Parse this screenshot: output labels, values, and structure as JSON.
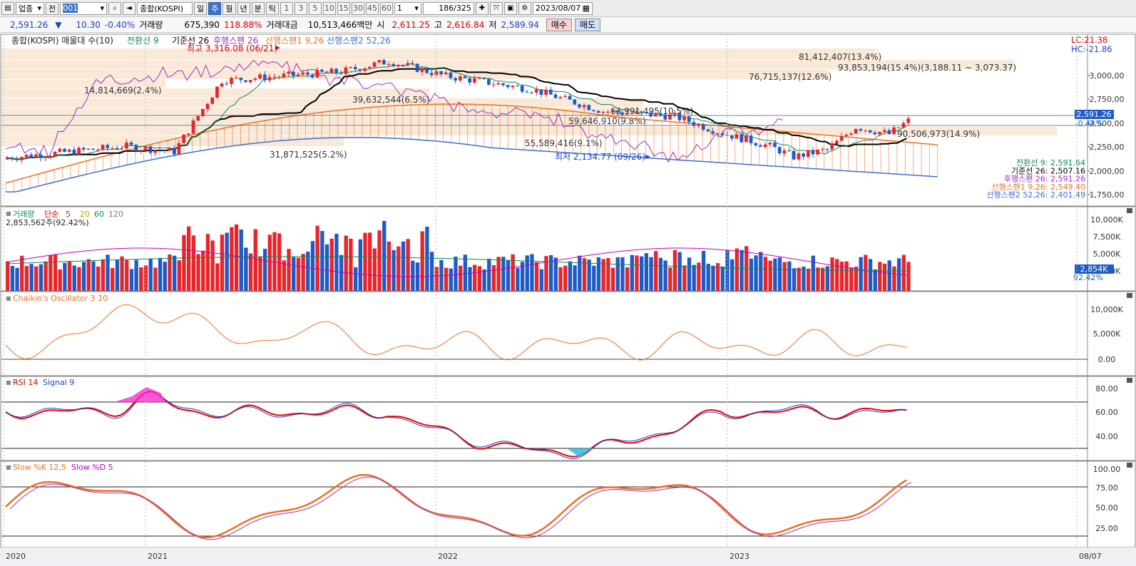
{
  "toolbar": {
    "market": "업종",
    "prev_label": "전",
    "code": "001",
    "index_name": "종합(KOSPI)",
    "periods": [
      "일",
      "주",
      "월",
      "년",
      "분",
      "틱"
    ],
    "selected_period": "주",
    "tick_numbers": [
      "1",
      "3",
      "5",
      "10",
      "15",
      "30",
      "45",
      "60"
    ],
    "interval": "1",
    "count": "186",
    "total": "/325",
    "date": "2023/08/07"
  },
  "quote": {
    "price": "2,591.26",
    "arrow": "▼",
    "change": "10.30",
    "pct": "-0.40%",
    "vol_label": "거래량",
    "volume": "675,390",
    "vol_ratio": "118.88%",
    "amt_label": "거래대금",
    "amount": "10,513,466백만",
    "open_label": "시",
    "open": "2,611.25",
    "high_label": "고",
    "high": "2,616.84",
    "low_label": "저",
    "low": "2,589.94",
    "buy_label": "매수",
    "sell_label": "매도"
  },
  "panels": {
    "price": {
      "title": "종합(KOSPI) 매물대 수(10)",
      "legend": [
        {
          "text": "전환선 9",
          "color": "#0a8a5a"
        },
        {
          "text": "기준선 26",
          "color": "#000000"
        },
        {
          "text": "후행스팬 26",
          "color": "#9a2fc0"
        },
        {
          "text": "선행스팬1 9,26",
          "color": "#f07020"
        },
        {
          "text": "선행스팬2 52,26",
          "color": "#3a6fd8"
        }
      ],
      "axis": [
        "3,000,00",
        "2,750,00",
        "2,500,00",
        "2,250,00",
        "2,000,00",
        "1,750,00"
      ],
      "lc": "LC:21.38",
      "hc": "HC:-21.86",
      "last_price": "2,591.26",
      "last_pct": "-0.44%",
      "high_note": "최고 3,316.08 (06/21)",
      "low_note": "최저 2,134.77 (09/26)",
      "volprofile": [
        "81,412,407(13.4%)",
        "93,853,194(15.4%)(3,188.11 ~ 3,073.37)",
        "76,715,137(12.6%)",
        "14,814,669(2.4%)",
        "39,632,544(6.5%)",
        "63,991,495(10.5%)",
        "59,646,910(9.8%)",
        "55,589,416(9.1%)",
        "90,506,973(14.9%)",
        "31,871,525(5.2%)"
      ],
      "ichimoku_values": [
        {
          "text": "전환선 9: 2,591.64",
          "color": "#0a8a5a"
        },
        {
          "text": "기준선 26: 2,507.16",
          "color": "#000000"
        },
        {
          "text": "후행스팬 26: 2,591.26",
          "color": "#9a2fc0"
        },
        {
          "text": "선행스팬1 9,26: 2,549.40",
          "color": "#f07020"
        },
        {
          "text": "선행스팬2 52,26: 2,401.49",
          "color": "#3a6fd8"
        }
      ]
    },
    "volume": {
      "title": "거래량",
      "ma_label": "단순",
      "ma": [
        "5",
        "20",
        "60",
        "120"
      ],
      "value_text": "2,853,562주(92.42%)",
      "axis": [
        "10,000K",
        "7,500K",
        "5,000K",
        "2,500K"
      ],
      "last": "2,854K",
      "last_pct": "92.42%"
    },
    "chaikin": {
      "title": "Chaikin's Oscillator 3 10",
      "axis": [
        "10,000K",
        "5,000K",
        "0.00"
      ]
    },
    "rsi": {
      "title": "RSI 14",
      "signal": "Signal 9",
      "axis": [
        "80.00",
        "60.00",
        "40.00"
      ]
    },
    "stoch": {
      "title": "Slow %K 12,5",
      "signal": "Slow %D 5",
      "axis": [
        "100.00",
        "75.00",
        "50.00",
        "25.00"
      ]
    }
  },
  "xaxis": [
    "2020",
    "2021",
    "2022",
    "2023",
    "08/07"
  ],
  "colors": {
    "up": "#e8252a",
    "down": "#1f5bc6",
    "span1": "#f07020",
    "span2": "#3a6fd8",
    "cloud_up": "#f5c9a6",
    "cloud_down": "#a9c3ef",
    "lagging": "#9a2fc0",
    "kijun": "#000000",
    "tenkan": "#0a8a5a"
  }
}
